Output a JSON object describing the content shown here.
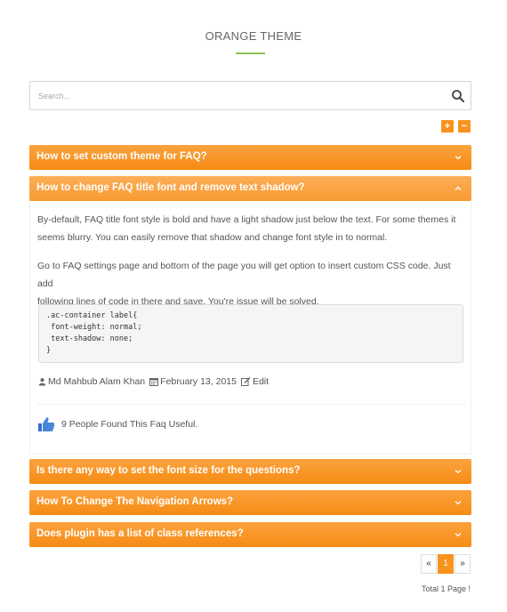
{
  "theme": {
    "title": "ORANGE THEME",
    "accent_color": "#f7941d",
    "underline_color": "#8cc152"
  },
  "search": {
    "placeholder": "Search...",
    "icon": "search-icon"
  },
  "controls": {
    "expand_label": "+",
    "collapse_label": "−"
  },
  "faqs": [
    {
      "title": "How to set custom theme for FAQ?",
      "open": false
    },
    {
      "title": "How to change FAQ title font and remove text shadow?",
      "open": true
    },
    {
      "title": "Is there any way to set the font size for the questions?",
      "open": false
    },
    {
      "title": "How To Change The Navigation Arrows?",
      "open": false
    },
    {
      "title": "Does plugin has a list of class references?",
      "open": false
    }
  ],
  "open_faq": {
    "paragraph1_line1": "By-default, FAQ title font style is bold and have a light shadow just below the text. For some themes it",
    "paragraph1_line2": "seems blurry. You can easily remove that shadow and change font style in to normal.",
    "paragraph2_line1": "Go to FAQ settings page and bottom of the page you will get option to insert custom CSS code. Just add",
    "paragraph2_line2": "following lines of code in there and save. You're issue will be solved.",
    "code_lines": [
      ".ac-container label{",
      " font-weight: normal;",
      " text-shadow: none;",
      "}"
    ],
    "author": "Md Mahbub Alam Khan",
    "date": "February 13, 2015",
    "edit_label": "Edit",
    "useful_text": "9 People Found This Faq Useful."
  },
  "pagination": {
    "prev": "«",
    "current": "1",
    "next": "»",
    "total": "Total 1 Page !"
  }
}
